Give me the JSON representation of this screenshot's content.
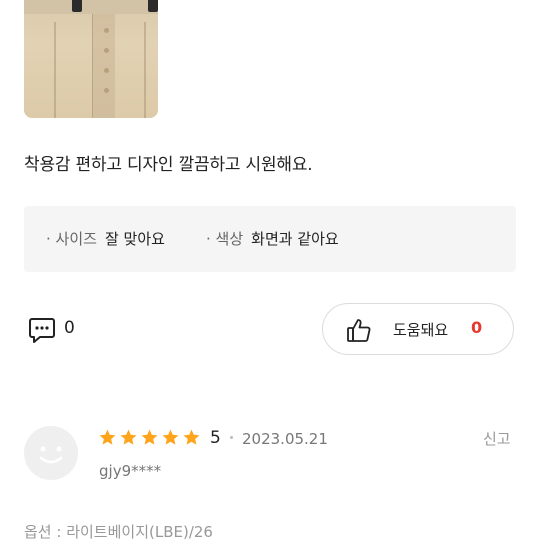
{
  "review": {
    "text": "착용감 편하고 디자인 깔끔하고 시원해요.",
    "attributes": [
      {
        "key": "사이즈",
        "value": "잘 맞아요"
      },
      {
        "key": "색상",
        "value": "화면과 같아요"
      }
    ],
    "comments": {
      "count": "0",
      "icon": "speech-bubble-icon"
    },
    "helpful": {
      "label": "도움돼요",
      "count": "0",
      "icon": "thumbs-up-icon"
    }
  },
  "next_review": {
    "rating": "5",
    "rating_value": 5,
    "rating_max": 5,
    "date": "2023.05.21",
    "report_label": "신고",
    "user": "gjy9****",
    "option": "옵션 : 라이트베이지(LBE)/26"
  },
  "colors": {
    "accent": "#e8372c",
    "star": "#ffa41b",
    "attr_background": "#f5f5f5"
  }
}
